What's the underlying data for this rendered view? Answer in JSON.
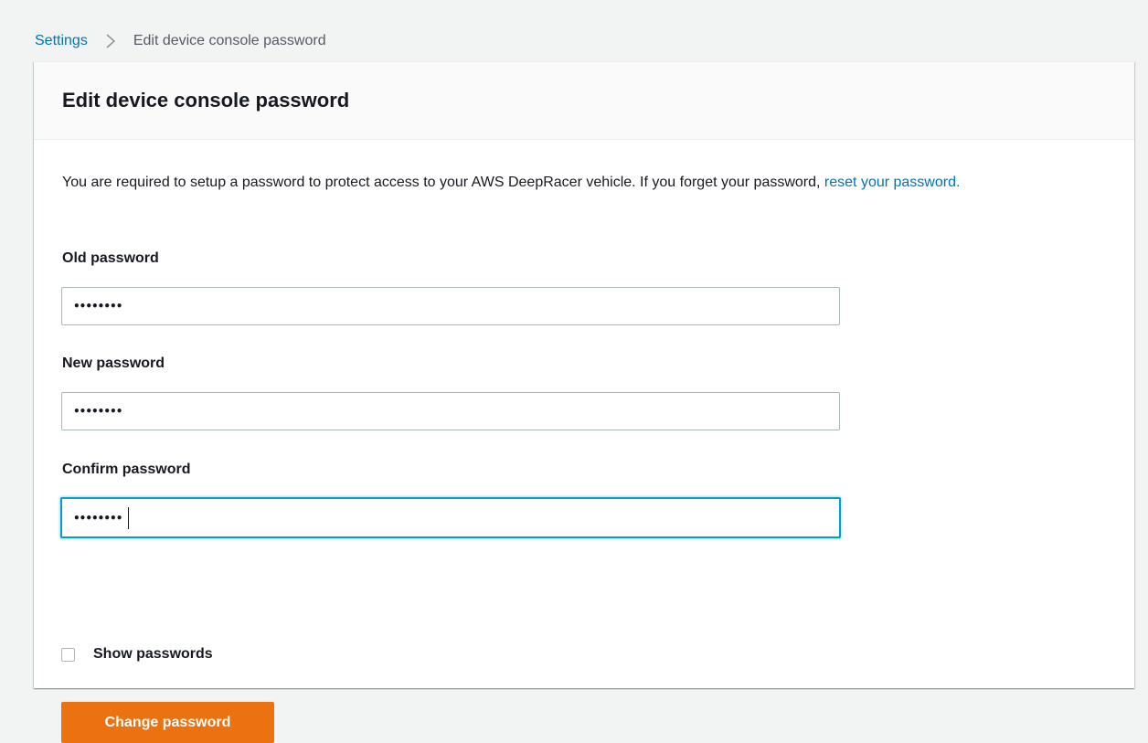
{
  "breadcrumb": {
    "parent": "Settings",
    "current": "Edit device console password"
  },
  "panel": {
    "title": "Edit device console password",
    "description_text": "You are required to setup a password to protect access to your AWS DeepRacer vehicle. If you forget your password, ",
    "description_link": "reset your password."
  },
  "form": {
    "old_password": {
      "label": "Old password",
      "value": "••••••••"
    },
    "new_password": {
      "label": "New password",
      "value": "••••••••"
    },
    "confirm_password": {
      "label": "Confirm password",
      "value": "••••••••"
    },
    "show_passwords": {
      "label": "Show passwords",
      "checked": false
    },
    "submit_label": "Change password"
  },
  "colors": {
    "accent": "#ec7211",
    "link": "#0073bb",
    "focus": "#00a1c9"
  },
  "icons": {
    "breadcrumb_separator": "chevron-right-icon"
  }
}
